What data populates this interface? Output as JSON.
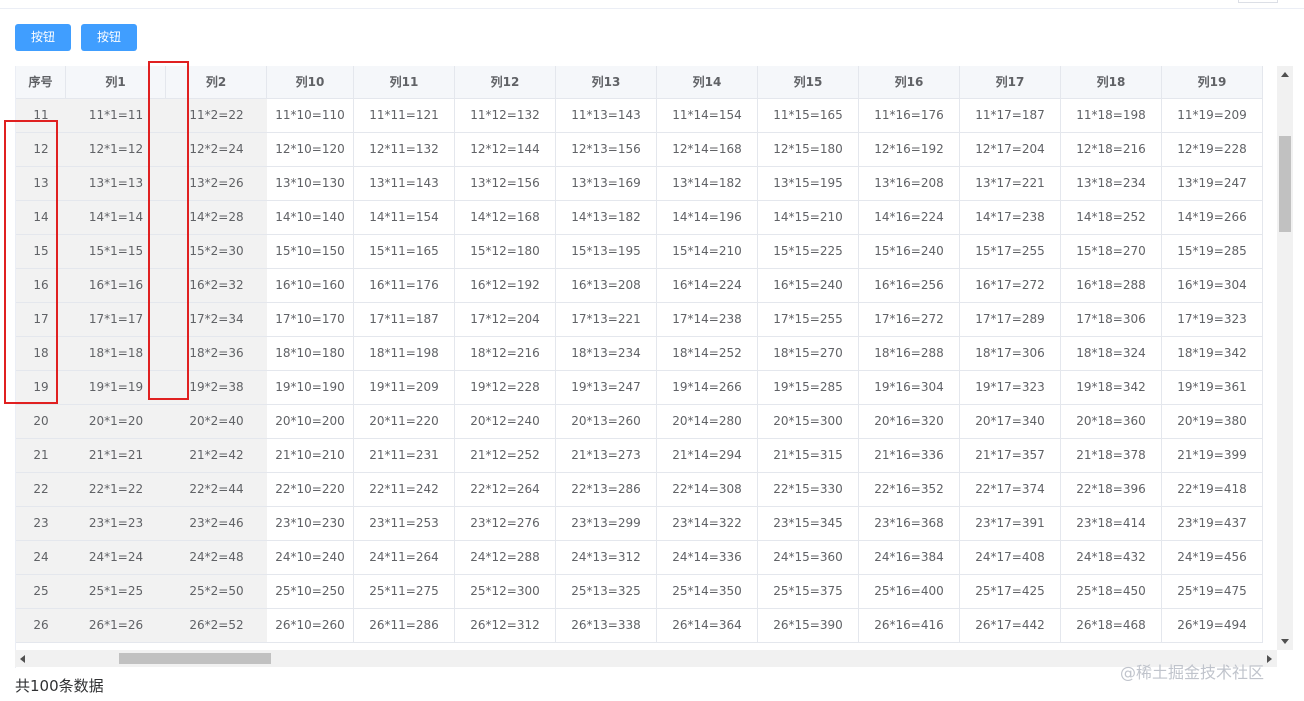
{
  "toolbar": {
    "button1_label": "按钮",
    "button2_label": "按钮"
  },
  "table": {
    "columns": [
      "序号",
      "列1",
      "列2",
      "列10",
      "列11",
      "列12",
      "列13",
      "列14",
      "列15",
      "列16",
      "列17",
      "列18",
      "列19"
    ],
    "rows": [
      [
        "11",
        "11*1=11",
        "11*2=22",
        "11*10=110",
        "11*11=121",
        "11*12=132",
        "11*13=143",
        "11*14=154",
        "11*15=165",
        "11*16=176",
        "11*17=187",
        "11*18=198",
        "11*19=209"
      ],
      [
        "12",
        "12*1=12",
        "12*2=24",
        "12*10=120",
        "12*11=132",
        "12*12=144",
        "12*13=156",
        "12*14=168",
        "12*15=180",
        "12*16=192",
        "12*17=204",
        "12*18=216",
        "12*19=228"
      ],
      [
        "13",
        "13*1=13",
        "13*2=26",
        "13*10=130",
        "13*11=143",
        "13*12=156",
        "13*13=169",
        "13*14=182",
        "13*15=195",
        "13*16=208",
        "13*17=221",
        "13*18=234",
        "13*19=247"
      ],
      [
        "14",
        "14*1=14",
        "14*2=28",
        "14*10=140",
        "14*11=154",
        "14*12=168",
        "14*13=182",
        "14*14=196",
        "14*15=210",
        "14*16=224",
        "14*17=238",
        "14*18=252",
        "14*19=266"
      ],
      [
        "15",
        "15*1=15",
        "15*2=30",
        "15*10=150",
        "15*11=165",
        "15*12=180",
        "15*13=195",
        "15*14=210",
        "15*15=225",
        "15*16=240",
        "15*17=255",
        "15*18=270",
        "15*19=285"
      ],
      [
        "16",
        "16*1=16",
        "16*2=32",
        "16*10=160",
        "16*11=176",
        "16*12=192",
        "16*13=208",
        "16*14=224",
        "16*15=240",
        "16*16=256",
        "16*17=272",
        "16*18=288",
        "16*19=304"
      ],
      [
        "17",
        "17*1=17",
        "17*2=34",
        "17*10=170",
        "17*11=187",
        "17*12=204",
        "17*13=221",
        "17*14=238",
        "17*15=255",
        "17*16=272",
        "17*17=289",
        "17*18=306",
        "17*19=323"
      ],
      [
        "18",
        "18*1=18",
        "18*2=36",
        "18*10=180",
        "18*11=198",
        "18*12=216",
        "18*13=234",
        "18*14=252",
        "18*15=270",
        "18*16=288",
        "18*17=306",
        "18*18=324",
        "18*19=342"
      ],
      [
        "19",
        "19*1=19",
        "19*2=38",
        "19*10=190",
        "19*11=209",
        "19*12=228",
        "19*13=247",
        "19*14=266",
        "19*15=285",
        "19*16=304",
        "19*17=323",
        "19*18=342",
        "19*19=361"
      ],
      [
        "20",
        "20*1=20",
        "20*2=40",
        "20*10=200",
        "20*11=220",
        "20*12=240",
        "20*13=260",
        "20*14=280",
        "20*15=300",
        "20*16=320",
        "20*17=340",
        "20*18=360",
        "20*19=380"
      ],
      [
        "21",
        "21*1=21",
        "21*2=42",
        "21*10=210",
        "21*11=231",
        "21*12=252",
        "21*13=273",
        "21*14=294",
        "21*15=315",
        "21*16=336",
        "21*17=357",
        "21*18=378",
        "21*19=399"
      ],
      [
        "22",
        "22*1=22",
        "22*2=44",
        "22*10=220",
        "22*11=242",
        "22*12=264",
        "22*13=286",
        "22*14=308",
        "22*15=330",
        "22*16=352",
        "22*17=374",
        "22*18=396",
        "22*19=418"
      ],
      [
        "23",
        "23*1=23",
        "23*2=46",
        "23*10=230",
        "23*11=253",
        "23*12=276",
        "23*13=299",
        "23*14=322",
        "23*15=345",
        "23*16=368",
        "23*17=391",
        "23*18=414",
        "23*19=437"
      ],
      [
        "24",
        "24*1=24",
        "24*2=48",
        "24*10=240",
        "24*11=264",
        "24*12=288",
        "24*13=312",
        "24*14=336",
        "24*15=360",
        "24*16=384",
        "24*17=408",
        "24*18=432",
        "24*19=456"
      ],
      [
        "25",
        "25*1=25",
        "25*2=50",
        "25*10=250",
        "25*11=275",
        "25*12=300",
        "25*13=325",
        "25*14=350",
        "25*15=375",
        "25*16=400",
        "25*17=425",
        "25*18=450",
        "25*19=475"
      ],
      [
        "26",
        "26*1=26",
        "26*2=52",
        "26*10=260",
        "26*11=286",
        "26*12=312",
        "26*13=338",
        "26*14=364",
        "26*15=390",
        "26*16=416",
        "26*17=442",
        "26*18=468",
        "26*19=494"
      ]
    ]
  },
  "footer": {
    "total_text": "共100条数据"
  },
  "watermark": "@稀土掘金技术社区"
}
